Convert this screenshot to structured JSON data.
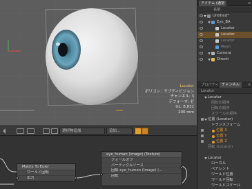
{
  "viewport": {
    "info_lines": [
      "Locator",
      "ポリゴン：サブディビジョン",
      "チャンネル: 3",
      "デフォーマ: ゼ",
      "GL: 8,832",
      "200 mm"
    ]
  },
  "toolbar": {
    "add_item_label": "選択物追加",
    "add_label": "追加..."
  },
  "schematic": {
    "matrix_node": {
      "title": "Matrix To Euler",
      "rows": [
        "ワールド回転",
        "出力"
      ]
    },
    "texture_node": {
      "title": "eye_human (Image) (Texture)",
      "rows": [
        "フォールオフ",
        "パーティクルソース",
        "回転 eye_human (Image) (...",
        "回転"
      ]
    }
  },
  "outliner": {
    "tabs": [
      "アイテム (通常",
      "≡"
    ],
    "column_header": "名前",
    "rows": [
      {
        "label": "Untitled*",
        "indent": 0,
        "icon": "scene-icon",
        "selected": false,
        "dim": false
      },
      {
        "label": "Eye_BA",
        "indent": 1,
        "icon": "mesh-icon",
        "selected": false,
        "dim": false
      },
      {
        "label": "Locator",
        "indent": 2,
        "icon": "locator-icon",
        "selected": false,
        "dim": false
      },
      {
        "label": "Locator",
        "indent": 2,
        "icon": "locator-icon",
        "selected": true,
        "dim": false
      },
      {
        "label": "Locator",
        "indent": 2,
        "icon": "locator-icon",
        "selected": false,
        "dim": true
      },
      {
        "label": "Mesh",
        "indent": 2,
        "icon": "mesh-icon",
        "selected": false,
        "dim": true
      },
      {
        "label": "Camera",
        "indent": 1,
        "icon": "camera-icon",
        "selected": false,
        "dim": false
      },
      {
        "label": "Directi",
        "indent": 1,
        "icon": "light-icon",
        "selected": false,
        "dim": false
      }
    ]
  },
  "properties": {
    "tabs": [
      "プロパティ",
      "チャンネル",
      "≡"
    ],
    "header": "Locator",
    "rows": [
      {
        "label": "Locator",
        "indent": 1,
        "style": "normal",
        "check": false,
        "dot": false,
        "tri": true
      },
      {
        "label": "回転の順序",
        "indent": 2,
        "style": "dim",
        "check": false,
        "dot": false,
        "tri": false
      },
      {
        "label": "回転の順序",
        "indent": 2,
        "style": "dim",
        "check": false,
        "dot": false,
        "tri": false
      },
      {
        "label": "スケールの順序",
        "indent": 2,
        "style": "dim",
        "check": false,
        "dot": false,
        "tri": false
      },
      {
        "label": "位置 (Locator)",
        "indent": 1,
        "style": "normal",
        "check": true,
        "dot": false,
        "tri": true
      },
      {
        "label": "トランスフォーム",
        "indent": 2,
        "style": "normal",
        "check": false,
        "dot": false,
        "tri": false
      },
      {
        "label": "位置 X",
        "indent": 2,
        "style": "orange",
        "check": true,
        "dot": true,
        "tri": false
      },
      {
        "label": "位置 Y",
        "indent": 2,
        "style": "orange",
        "check": true,
        "dot": true,
        "tri": false
      },
      {
        "label": "位置 Z",
        "indent": 2,
        "style": "orange",
        "check": true,
        "dot": true,
        "tri": false
      },
      {
        "label": "回転 (Locator)",
        "indent": 1,
        "style": "dim",
        "check": false,
        "dot": false,
        "tri": false
      },
      {
        "label": "",
        "indent": 0,
        "style": "normal",
        "check": false,
        "dot": false,
        "tri": false
      },
      {
        "label": "Locator",
        "indent": 1,
        "style": "normal",
        "check": false,
        "dot": false,
        "tri": true
      },
      {
        "label": "ローカル",
        "indent": 2,
        "style": "normal",
        "check": false,
        "dot": false,
        "tri": false
      },
      {
        "label": "ペアレント",
        "indent": 2,
        "style": "normal",
        "check": false,
        "dot": false,
        "tri": false
      },
      {
        "label": "ワールド位置",
        "indent": 2,
        "style": "normal",
        "check": false,
        "dot": false,
        "tri": false
      },
      {
        "label": "ワールド回転",
        "indent": 2,
        "style": "normal",
        "check": false,
        "dot": false,
        "tri": false
      },
      {
        "label": "ワールドスケール",
        "indent": 2,
        "style": "normal",
        "check": false,
        "dot": false,
        "tri": false
      }
    ]
  },
  "colors": {
    "accent": "#e59e2c",
    "selection": "#6a4f2a",
    "iris": "#5a8fa8",
    "sclera": "#e8e8e8"
  }
}
